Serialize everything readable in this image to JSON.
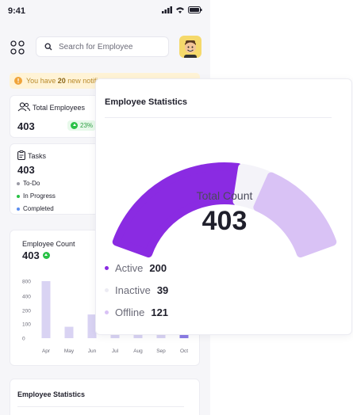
{
  "status_bar": {
    "time": "9:41"
  },
  "search": {
    "placeholder": "Search for Employee"
  },
  "notification": {
    "prefix": "You have",
    "count": "20",
    "suffix": "new notific"
  },
  "total_employees": {
    "label": "Total Employees",
    "value": "403",
    "change": "23%"
  },
  "tasks": {
    "label": "Tasks",
    "value": "403",
    "legend": [
      {
        "label": "To-Do",
        "color": "#9b9ba6"
      },
      {
        "label": "In Progress",
        "color": "#28c145"
      },
      {
        "label": "Completed",
        "color": "#5b8def"
      }
    ]
  },
  "employee_count": {
    "label": "Employee Count",
    "value": "403",
    "chart_data": {
      "type": "bar",
      "categories": [
        "Apr",
        "May",
        "Jun",
        "Jul",
        "Aug",
        "Sep",
        "Oct"
      ],
      "values": [
        800,
        80,
        170,
        40,
        40,
        40,
        60
      ],
      "y_ticks": [
        "800",
        "400",
        "200",
        "100",
        "0"
      ],
      "ylim": [
        0,
        800
      ],
      "colors": {
        "bar": "#d9d3f3",
        "highlight": "#8c7de6"
      }
    }
  },
  "bottom_card": {
    "title": "Employee Statistics"
  },
  "overlay": {
    "title": "Employee Statistics",
    "center_label": "Total Count",
    "center_value": "403",
    "chart_data": {
      "type": "pie",
      "series": [
        {
          "name": "Active",
          "value": 200,
          "color": "#8a2be2"
        },
        {
          "name": "Inactive",
          "value": 39,
          "color": "#f4f3f9"
        },
        {
          "name": "Offline",
          "value": 121,
          "color": "#d9c2f5"
        }
      ]
    }
  }
}
